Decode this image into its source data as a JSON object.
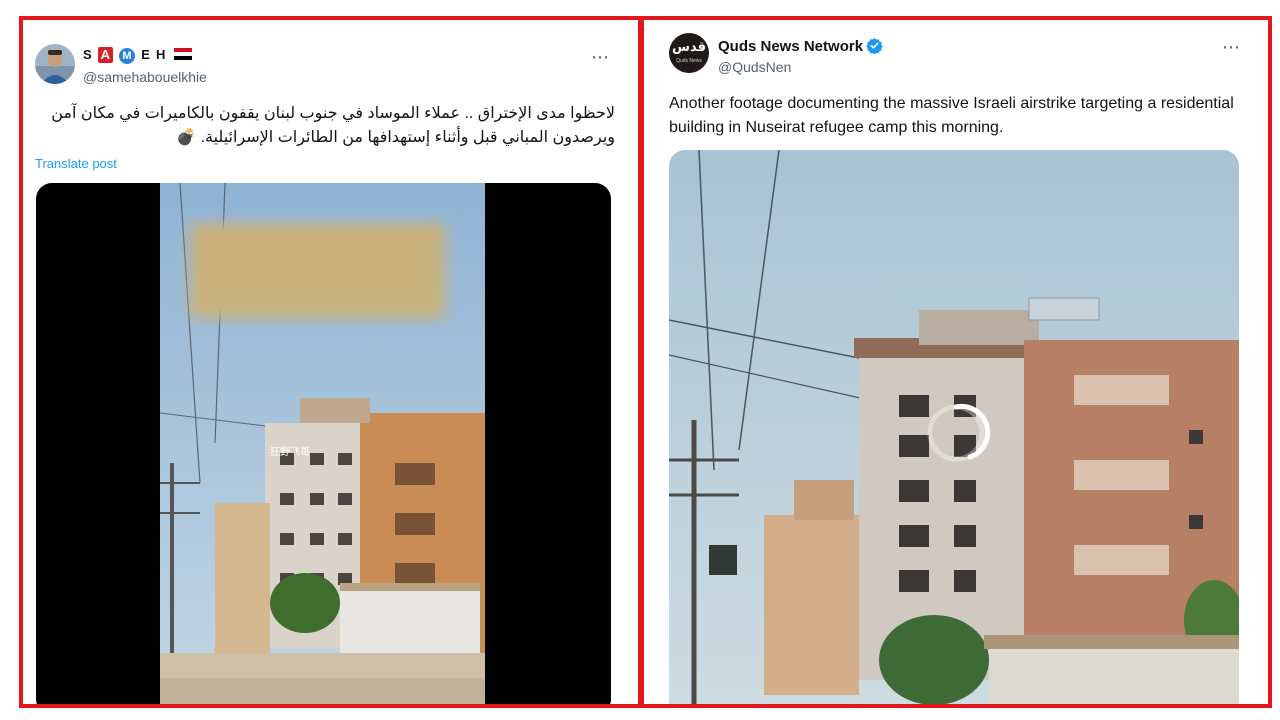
{
  "left_post": {
    "name_parts": [
      "S",
      "A",
      "M",
      "E",
      "H"
    ],
    "handle": "@samehabouelkhie",
    "more_icon": "⋯",
    "text": "لاحظوا مدى الإختراق .. عملاء الموساد في جنوب لبنان يقفون بالكاميرات في مكان آمن ويرصدون المباني قبل وأثناء إستهدافها من الطائرات الإسرائيلية.",
    "bomb_emoji": "💣",
    "translate_label": "Translate post",
    "watermark": "狂野飞哥"
  },
  "right_post": {
    "name": "Quds News Network",
    "handle": "@QudsNen",
    "more_icon": "⋯",
    "avatar_text_main": "قدس",
    "avatar_text_sub": "Quds News",
    "text": "Another footage documenting the massive Israeli airstrike targeting a residential building in Nuseirat refugee camp this morning."
  },
  "colors": {
    "frame_red": "#e2171f",
    "link_blue": "#1d9bf0",
    "verified_blue": "#1d9bf0",
    "secondary_text": "#536471"
  }
}
